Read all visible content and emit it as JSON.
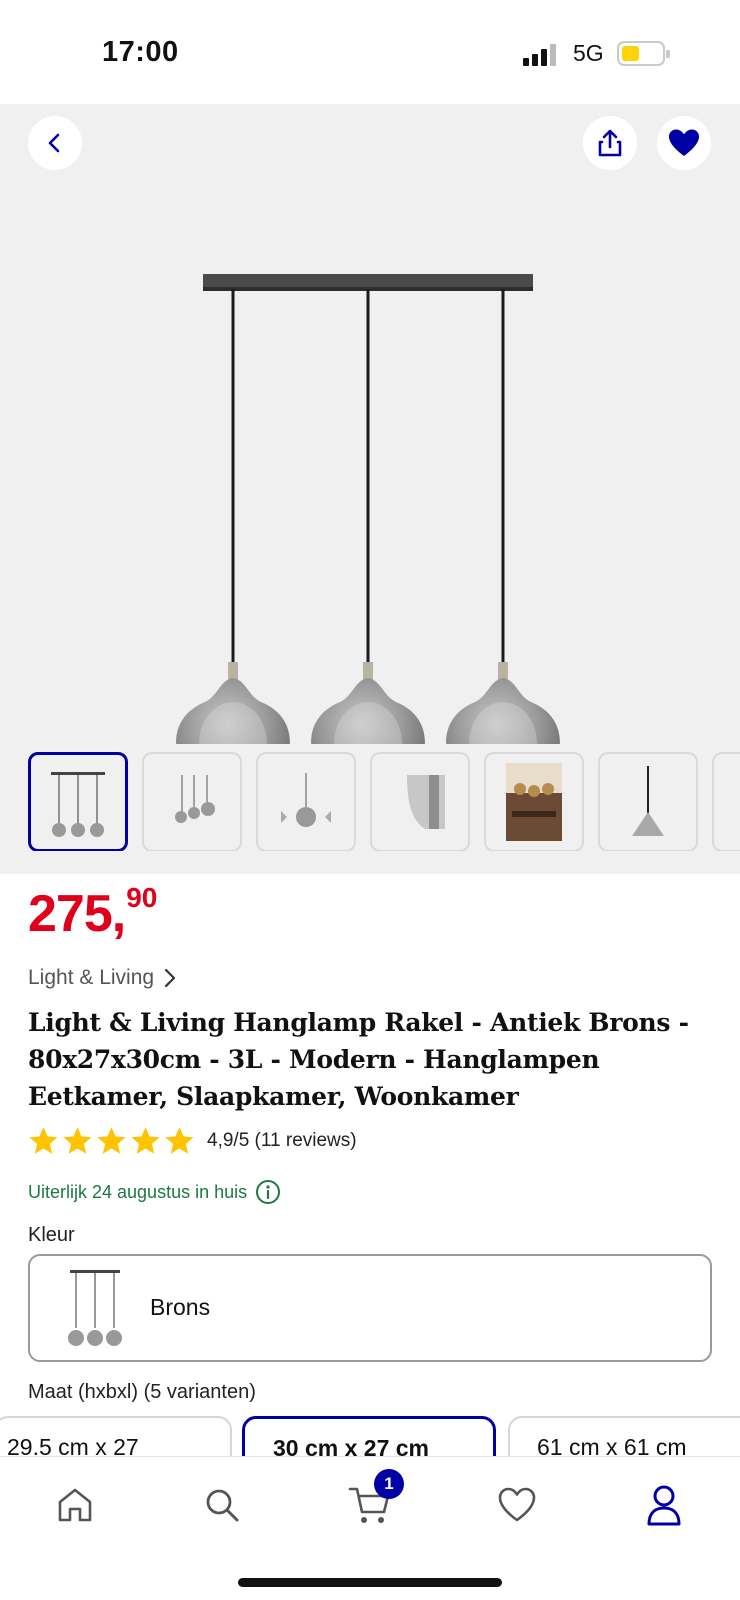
{
  "status_bar": {
    "time": "17:00",
    "network": "5G"
  },
  "gallery": {
    "icons": {
      "back": "chevron-left-icon",
      "share": "share-icon",
      "favorite": "heart-filled-icon"
    },
    "thumbnails": [
      "front",
      "side",
      "single-shade",
      "shade-detail",
      "lifestyle-room",
      "cone-shade",
      "more"
    ]
  },
  "product": {
    "price_main": "275,",
    "price_cents": "90",
    "brand": "Light & Living",
    "title": "Light & Living Hanglamp Rakel - Antiek Brons - 80x27x30cm - 3L - Modern - Hanglampen Eetkamer, Slaapkamer, Woonkamer",
    "rating_text": "4,9/5 (11 reviews)",
    "rating_value": 4.9,
    "rating_max": 5,
    "delivery": "Uiterlijk 24 augustus in huis"
  },
  "color": {
    "label": "Kleur",
    "selected": "Brons"
  },
  "size": {
    "label": "Maat (hxbxl) (5 varianten)",
    "options": [
      "29.5 cm x 27",
      "30 cm x 27 cm",
      "61 cm x 61 cm"
    ],
    "selected_index": 1
  },
  "tabbar": {
    "items": [
      "home-icon",
      "search-icon",
      "cart-icon",
      "heart-icon",
      "profile-icon"
    ],
    "cart_count": "1"
  },
  "colors": {
    "accent": "#0000a4",
    "price": "#e0001b",
    "star": "#ffc300",
    "delivery": "#1b7a3e"
  }
}
